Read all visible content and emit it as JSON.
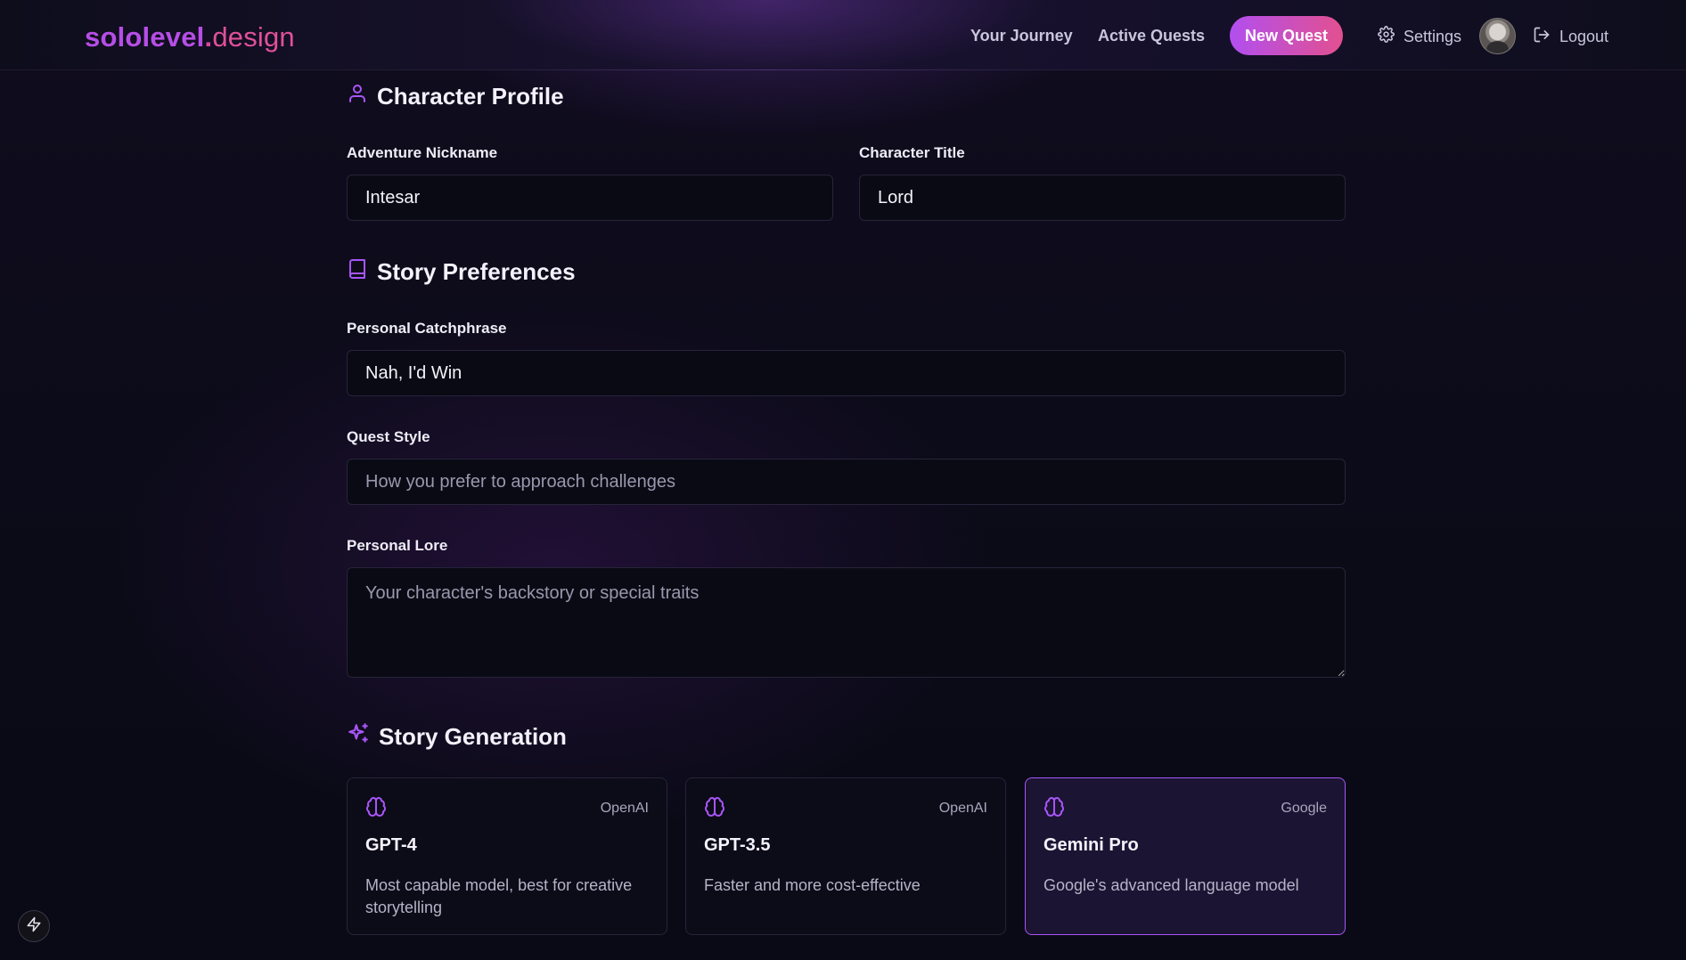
{
  "header": {
    "logo_brand": "sololevel",
    "logo_dot": ".",
    "logo_tld": "design",
    "nav": {
      "journey": "Your Journey",
      "quests": "Active Quests"
    },
    "new_quest_label": "New Quest",
    "settings_label": "Settings",
    "logout_label": "Logout"
  },
  "character_profile": {
    "title": "Character Profile",
    "nickname_label": "Adventure Nickname",
    "nickname_value": "Intesar",
    "title_label": "Character Title",
    "title_value": "Lord"
  },
  "story_preferences": {
    "title": "Story Preferences",
    "catchphrase_label": "Personal Catchphrase",
    "catchphrase_value": "Nah, I'd Win",
    "quest_style_label": "Quest Style",
    "quest_style_placeholder": "How you prefer to approach challenges",
    "lore_label": "Personal Lore",
    "lore_placeholder": "Your character's backstory or special traits"
  },
  "story_generation": {
    "title": "Story Generation",
    "selected_model": "Gemini Pro",
    "models": [
      {
        "provider": "OpenAI",
        "name": "GPT-4",
        "description": "Most capable model, best for creative storytelling"
      },
      {
        "provider": "OpenAI",
        "name": "GPT-3.5",
        "description": "Faster and more cost-effective"
      },
      {
        "provider": "Google",
        "name": "Gemini Pro",
        "description": "Google's advanced language model"
      }
    ]
  },
  "colors": {
    "accent": "#a855f7",
    "brand_pink": "#e2508f",
    "background": "#0b0b18"
  },
  "icons": {
    "profile": "user-icon",
    "preferences": "book-icon",
    "generation": "sparkles-icon",
    "model": "brain-icon",
    "settings": "gear-icon",
    "logout": "logout-icon",
    "floating": "lightning-icon"
  }
}
